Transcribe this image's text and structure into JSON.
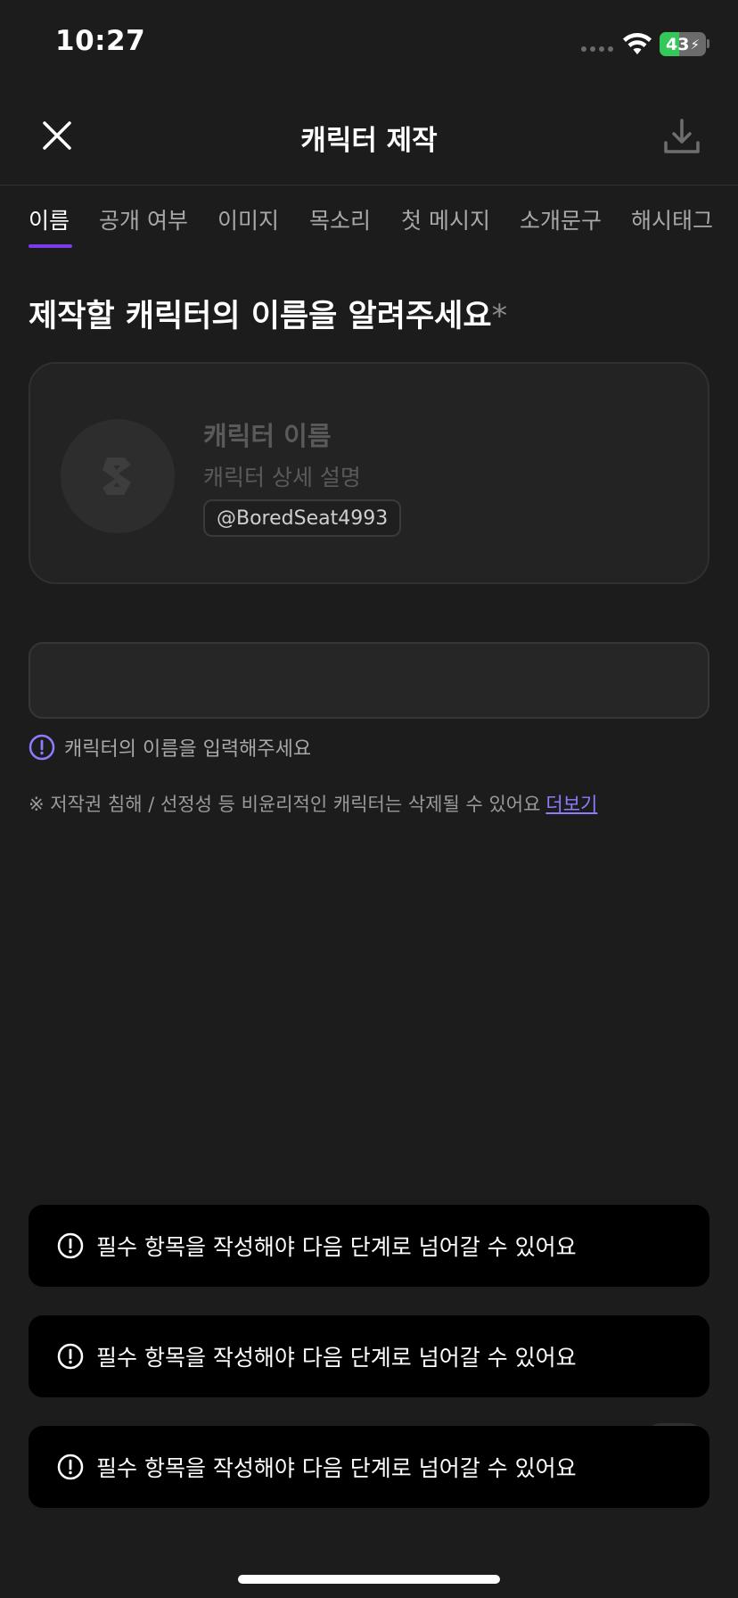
{
  "status": {
    "time": "10:27",
    "battery": "43",
    "battery_level": 0.43
  },
  "header": {
    "title": "캐릭터 제작"
  },
  "tabs": [
    {
      "label": "이름",
      "active": true
    },
    {
      "label": "공개 여부"
    },
    {
      "label": "이미지"
    },
    {
      "label": "목소리"
    },
    {
      "label": "첫 메시지"
    },
    {
      "label": "소개문구"
    },
    {
      "label": "해시태그"
    }
  ],
  "form": {
    "heading": "제작할 캐릭터의 이름을 알려주세요",
    "required_mark": "*",
    "input_value": "",
    "error": "캐릭터의 이름을 입력해주세요",
    "notice": "※ 저작권 침해 / 선정성 등 비윤리적인 캐릭터는 삭제될 수 있어요",
    "more_link": "더보기"
  },
  "preview": {
    "name": "캐릭터 이름",
    "description": "캐릭터 상세 설명",
    "handle": "@BoredSeat4993"
  },
  "toasts": [
    "필수 항목을 작성해야 다음 단계로 넘어갈 수 있어요",
    "필수 항목을 작성해야 다음 단계로 넘어갈 수 있어요",
    "필수 항목을 작성해야 다음 단계로 넘어갈 수 있어요"
  ],
  "colors": {
    "accent": "#7c3aed",
    "link": "#8b7dfb",
    "battery": "#34c759",
    "background": "#1c1c1c"
  },
  "icons": [
    "wifi-icon",
    "battery-icon",
    "close-icon",
    "download-icon",
    "logo-icon",
    "alert-circle-icon"
  ]
}
